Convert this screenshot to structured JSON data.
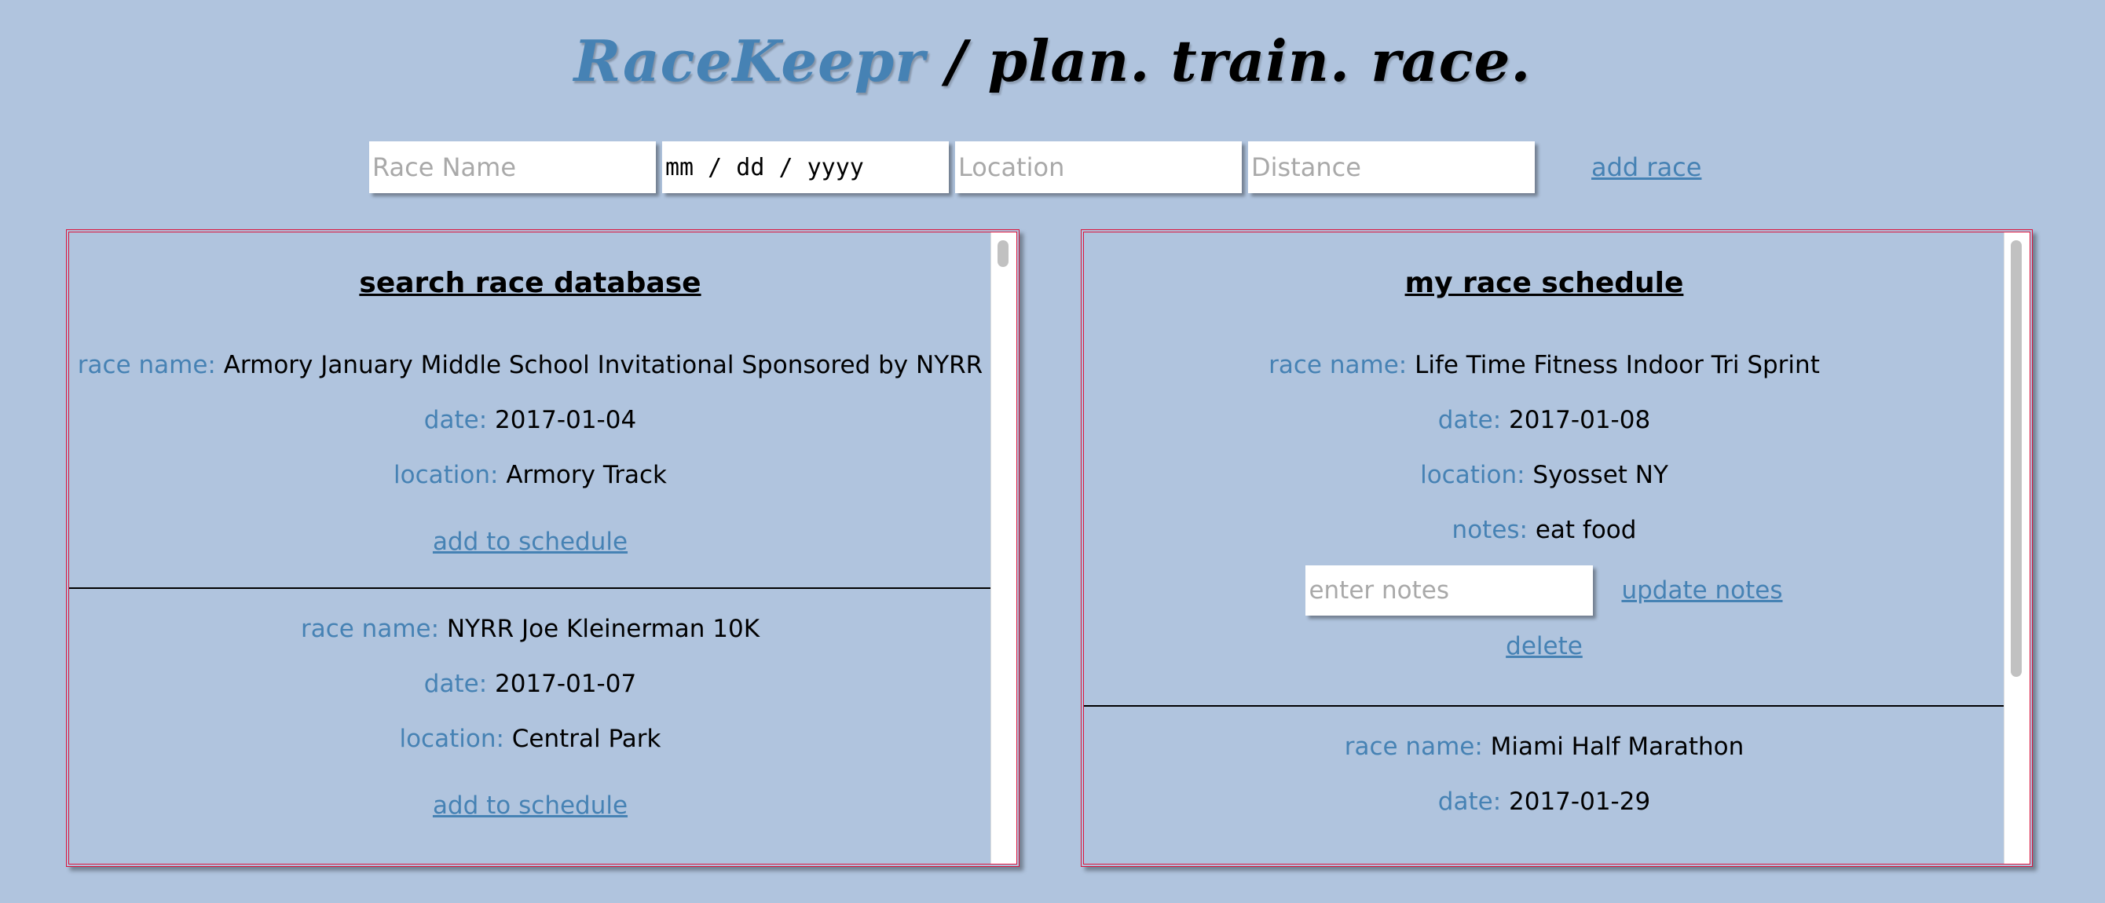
{
  "header": {
    "brand": "RaceKeepr",
    "tagline": " / plan. train. race."
  },
  "add_form": {
    "race_name_placeholder": "Race Name",
    "date_placeholder": "mm / dd / yyyy",
    "location_placeholder": "Location",
    "distance_placeholder": "Distance",
    "add_label": "add race"
  },
  "labels": {
    "race_name": "race name:",
    "date": "date:",
    "location": "location:",
    "notes": "notes:"
  },
  "search_panel": {
    "title": "search race database",
    "action_label": "add to schedule",
    "races": [
      {
        "name": "Armory January Middle School Invitational Sponsored by NYRR",
        "date": "2017-01-04",
        "location": "Armory Track"
      },
      {
        "name": "NYRR Joe Kleinerman 10K",
        "date": "2017-01-07",
        "location": "Central Park"
      }
    ]
  },
  "schedule_panel": {
    "title": "my race schedule",
    "notes_placeholder": "enter notes",
    "update_label": "update notes",
    "delete_label": "delete",
    "races": [
      {
        "name": "Life Time Fitness Indoor Tri Sprint",
        "date": "2017-01-08",
        "location": "Syosset NY",
        "notes": "eat food"
      },
      {
        "name": "Miami Half Marathon",
        "date": "2017-01-29"
      }
    ]
  },
  "colors": {
    "background": "#b0c4de",
    "accent": "#4682b4",
    "panel_border": "#dc143c"
  }
}
